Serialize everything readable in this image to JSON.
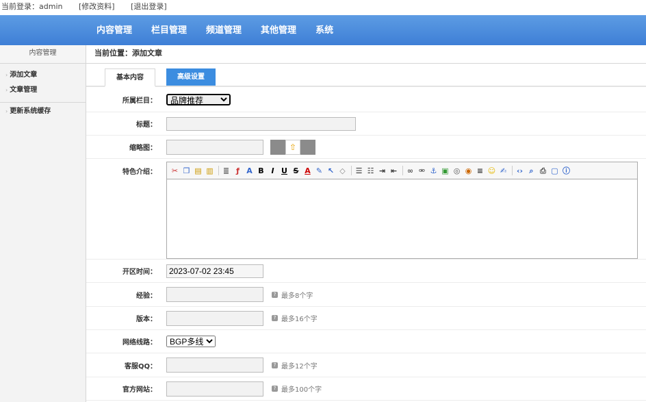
{
  "topbar": {
    "login_text": "当前登录：admin",
    "edit_profile": "[修改资料]",
    "logout": "[退出登录]"
  },
  "nav": {
    "items": [
      "内容管理",
      "栏目管理",
      "频道管理",
      "其他管理",
      "系统"
    ]
  },
  "sidebar": {
    "title": "内容管理",
    "items": [
      "添加文章",
      "文章管理"
    ],
    "items2": [
      "更新系统缓存"
    ]
  },
  "breadcrumb": "当前位置：添加文章",
  "tabs": {
    "basic": "基本内容",
    "advanced": "高级设置"
  },
  "form": {
    "category_label": "所属栏目：",
    "category_value": "品牌推荐",
    "title_label": "标题：",
    "title_value": "",
    "thumb_label": "缩略图：",
    "thumb_value": "",
    "feature_label": "特色介绍：",
    "opendate_label": "开区时间：",
    "opendate_value": "2023-07-02 23:45",
    "exp_label": "经验：",
    "exp_hint": "最多8个字",
    "version_label": "版本：",
    "version_hint": "最多16个字",
    "network_label": "网络线路：",
    "network_value": "BGP多线",
    "qq_label": "客服QQ：",
    "qq_hint": "最多12个字",
    "website_label": "官方网站：",
    "website_hint": "最多100个字"
  },
  "colors": {
    "nav_blue": "#3e7fd6",
    "tab_active_blue": "#3c8de0"
  }
}
